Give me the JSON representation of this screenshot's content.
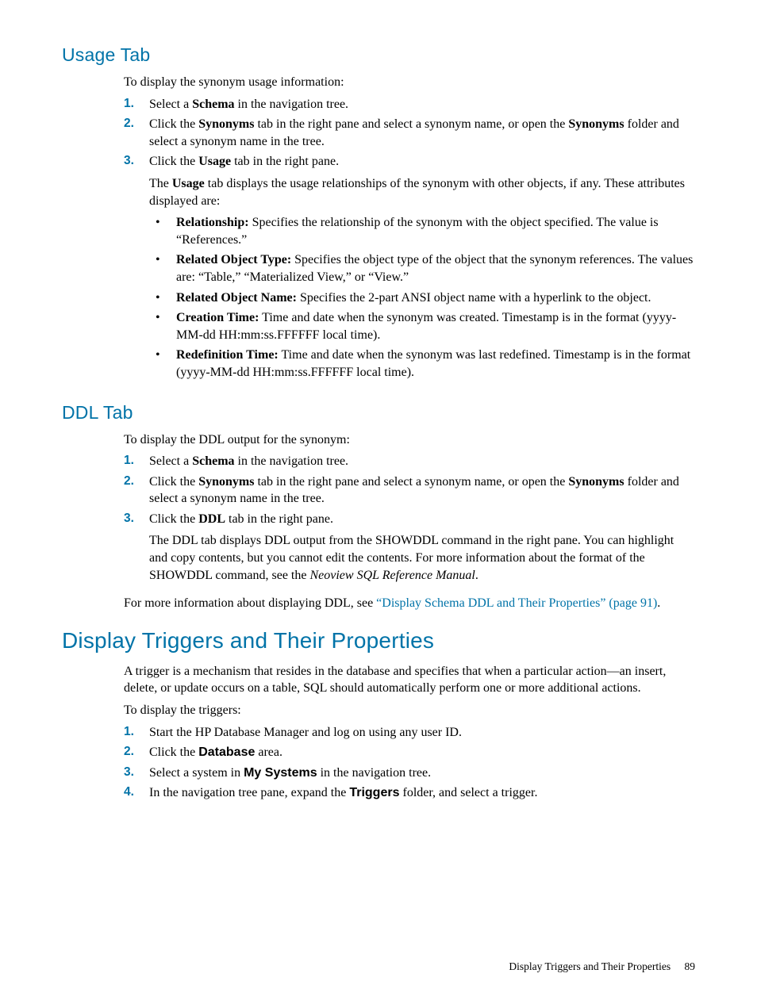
{
  "usage": {
    "heading": "Usage Tab",
    "intro": "To display the synonym usage information:",
    "steps": [
      {
        "num": "1.",
        "parts": [
          "Select a ",
          "Schema",
          " in the navigation tree."
        ]
      },
      {
        "num": "2.",
        "parts": [
          "Click the ",
          "Synonyms",
          " tab in the right pane and select a synonym name, or open the ",
          "Synonyms",
          " folder and select a synonym name in the tree."
        ]
      },
      {
        "num": "3.",
        "parts": [
          "Click the ",
          "Usage",
          " tab in the right pane."
        ]
      }
    ],
    "after_steps_p1a": "The ",
    "after_steps_p1b": "Usage",
    "after_steps_p1c": " tab displays the usage relationships of the synonym with other objects, if any. These attributes displayed are:",
    "bullets": [
      {
        "label": "Relationship:",
        "text": " Specifies the relationship of the synonym with the object specified. The value is “References.”"
      },
      {
        "label": "Related Object Type:",
        "text": " Specifies the object type of the object that the synonym references. The values are: “Table,” “Materialized View,” or “View.”"
      },
      {
        "label": "Related Object Name:",
        "text": " Specifies the 2-part ANSI object name with a hyperlink to the object."
      },
      {
        "label": "Creation Time:",
        "text": " Time and date when the synonym was created. Timestamp is in the format (yyyy-MM-dd HH:mm:ss.FFFFFF local time)."
      },
      {
        "label": "Redefinition Time:",
        "text": " Time and date when the synonym was last redefined. Timestamp is in the format (yyyy-MM-dd HH:mm:ss.FFFFFF local time)."
      }
    ]
  },
  "ddl": {
    "heading": "DDL Tab",
    "intro": "To display the DDL output for the synonym:",
    "steps": [
      {
        "num": "1.",
        "parts": [
          "Select a ",
          "Schema",
          " in the navigation tree."
        ]
      },
      {
        "num": "2.",
        "parts": [
          "Click the ",
          "Synonyms",
          " tab in the right pane and select a synonym name, or open the ",
          "Synonyms",
          " folder and select a synonym name in the tree."
        ]
      },
      {
        "num": "3.",
        "parts": [
          "Click the ",
          "DDL",
          " tab in the right pane."
        ]
      }
    ],
    "after_a": "The DDL tab displays DDL output from the SHOWDDL command in the right pane. You can highlight and copy contents, but you cannot edit the contents. For more information about the format of the SHOWDDL command, see the ",
    "after_ital": "Neoview SQL Reference Manual",
    "after_b": ".",
    "more_a": "For more information about displaying DDL, see ",
    "more_link": "“Display Schema DDL and Their Properties” (page 91)",
    "more_b": "."
  },
  "triggers": {
    "heading": "Display Triggers and Their Properties",
    "intro1": "A trigger is a mechanism that resides in the database and specifies that when a particular action—an insert, delete, or update occurs on a table, SQL should automatically perform one or more additional actions.",
    "intro2": "To display the triggers:",
    "steps": [
      {
        "num": "1.",
        "text": "Start the HP Database Manager and log on using any user ID."
      },
      {
        "num": "2.",
        "parts": [
          "Click the ",
          "Database",
          " area."
        ]
      },
      {
        "num": "3.",
        "parts": [
          "Select a system in ",
          "My Systems",
          " in the navigation tree."
        ]
      },
      {
        "num": "4.",
        "parts": [
          "In the navigation tree pane, expand the ",
          "Triggers",
          " folder, and select a trigger."
        ]
      }
    ]
  },
  "footer": {
    "title": "Display Triggers and Their Properties",
    "page": "89"
  }
}
